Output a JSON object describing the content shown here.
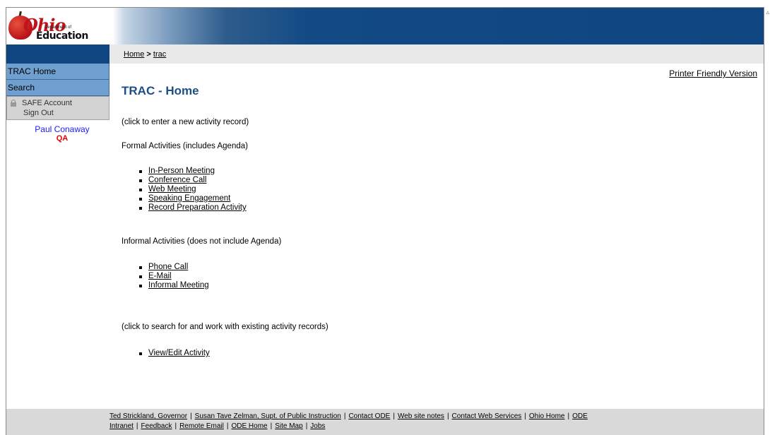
{
  "header": {
    "logo_text": "Ohio",
    "logo_dept": "Department of",
    "logo_edu": "Education"
  },
  "breadcrumb": {
    "home": "Home",
    "sep": ">",
    "current": "trac"
  },
  "sidebar": {
    "items": [
      {
        "label": "TRAC Home"
      },
      {
        "label": "Search"
      }
    ],
    "safe_account": "SAFE Account",
    "sign_out": "Sign Out",
    "user_name": "Paul Conaway",
    "user_role": "QA"
  },
  "main": {
    "printer_friendly": "Printer Friendly Version",
    "title": "TRAC - Home",
    "new_record_hint": "(click to enter a new activity record)",
    "formal_heading": "Formal Activities (includes Agenda)",
    "formal_items": [
      "In-Person Meeting",
      "Conference Call",
      "Web Meeting",
      "Speaking Engagement",
      "Record Preparation Activity"
    ],
    "informal_heading": "Informal Activities (does not include Agenda)",
    "informal_items": [
      "Phone Call",
      "E-Mail",
      "Informal Meeting"
    ],
    "search_hint": "(click to search for and work with existing activity records)",
    "existing_items": [
      "View/Edit Activity"
    ]
  },
  "footer": {
    "links": [
      "Ted Strickland, Governor",
      "Susan Tave Zelman, Supt. of Public Instruction",
      "Contact ODE",
      "Web site notes",
      "Contact Web Services",
      "Ohio Home",
      "ODE Intranet",
      "Feedback",
      "Remote Email",
      "ODE Home",
      "Site Map",
      "Jobs"
    ],
    "separator": "|"
  }
}
